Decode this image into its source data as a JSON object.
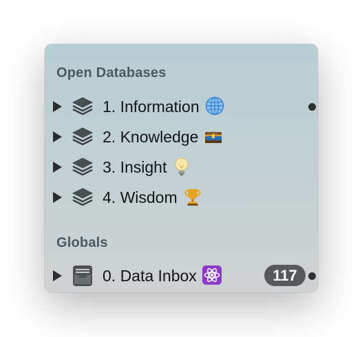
{
  "sections": {
    "open_databases": {
      "title": "Open Databases",
      "items": [
        {
          "label": "1. Information",
          "icon": "globe-icon",
          "indicator": "open"
        },
        {
          "label": "2. Knowledge",
          "icon": "treasure-chest-icon"
        },
        {
          "label": "3. Insight",
          "icon": "lightbulb-icon"
        },
        {
          "label": "4. Wisdom",
          "icon": "trophy-icon"
        }
      ]
    },
    "globals": {
      "title": "Globals",
      "items": [
        {
          "label": "0. Data Inbox",
          "icon": "atom-icon",
          "count": "117",
          "indicator": "open"
        }
      ]
    }
  },
  "colors": {
    "panel_top": "#b8ced4",
    "panel_bottom": "#cfd2d2",
    "badge": "#55595b",
    "header_text": "#4a5a60"
  }
}
